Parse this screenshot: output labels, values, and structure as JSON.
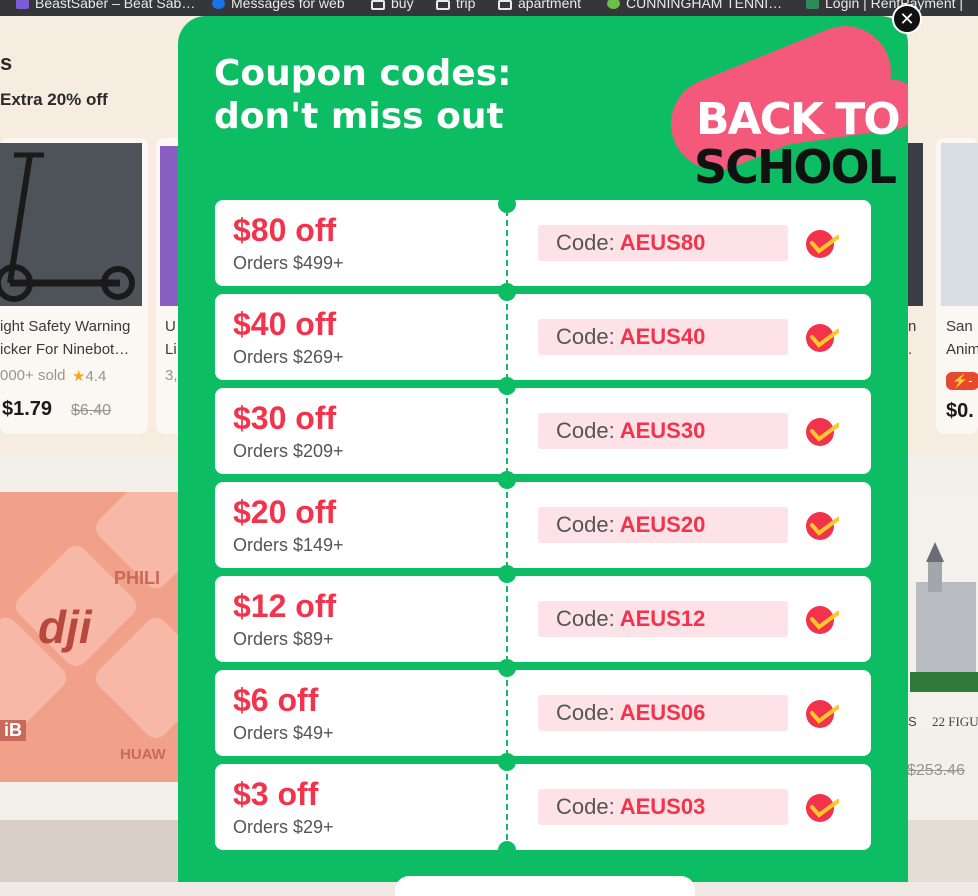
{
  "bookmarks": [
    {
      "label": "BeastSaber – Beat Sab…",
      "icon": "beastsaber-icon",
      "color": "#7b5cd6"
    },
    {
      "label": "Messages for web",
      "icon": "messages-icon",
      "color": "#1a73e8"
    },
    {
      "label": "buy",
      "icon": "folder-icon"
    },
    {
      "label": "trip",
      "icon": "folder-icon"
    },
    {
      "label": "apartment",
      "icon": "folder-icon"
    },
    {
      "label": "CUNNINGHAM TENNI…",
      "icon": "cunningham-icon",
      "color": "#6cc04a"
    },
    {
      "label": "Login | RentPayment |",
      "icon": "rentpayment-icon",
      "color": "#2e8b57"
    }
  ],
  "background_page": {
    "heading_fragment": "s",
    "subheading": "Extra 20% off",
    "product_left": {
      "title_line1": "ight Safety Warning",
      "title_line2": "icker For Ninebot…",
      "sold": "000+ sold",
      "rating": "4.4",
      "price": "$1.79",
      "original_price": "$6.40"
    },
    "product_second": {
      "title_line1": "U",
      "title_line2": "Li",
      "sold": "3,"
    },
    "product_right": {
      "title_line1": "San",
      "title_line2": "Anim",
      "badge": "-",
      "price": "$0."
    },
    "product_mid_right": {
      "text1": "n",
      "text2": "."
    },
    "brands": [
      "PHILI",
      "dji",
      "HUAW",
      "iB"
    ],
    "lego": {
      "label": "22 FIGU",
      "s_fragment": "S",
      "original_price": "$253.46"
    }
  },
  "modal": {
    "title": "Coupon codes:\ndon't miss out",
    "logo": {
      "line1": "BACK TO",
      "line2": "SCHOOL"
    },
    "code_label": "Code:",
    "coupons": [
      {
        "amount": "$80 off",
        "min_order": "Orders $499+",
        "code": "AEUS80"
      },
      {
        "amount": "$40 off",
        "min_order": "Orders $269+",
        "code": "AEUS40"
      },
      {
        "amount": "$30 off",
        "min_order": "Orders $209+",
        "code": "AEUS30"
      },
      {
        "amount": "$20 off",
        "min_order": "Orders $149+",
        "code": "AEUS20"
      },
      {
        "amount": "$12 off",
        "min_order": "Orders $89+",
        "code": "AEUS12"
      },
      {
        "amount": "$6 off",
        "min_order": "Orders $49+",
        "code": "AEUS06"
      },
      {
        "amount": "$3 off",
        "min_order": "Orders $29+",
        "code": "AEUS03"
      }
    ],
    "close_icon": "close-icon",
    "colors": {
      "modal_green": "#0dbd64",
      "amount_red": "#f2334b",
      "code_bg": "#fde3e7"
    }
  }
}
